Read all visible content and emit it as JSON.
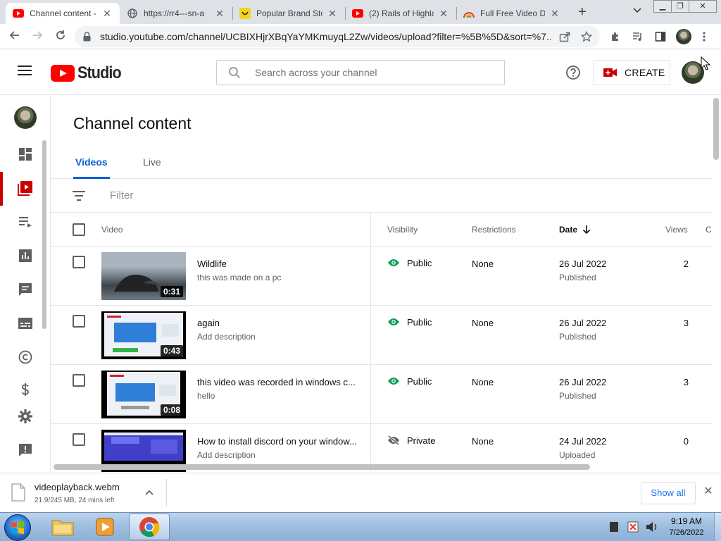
{
  "browser": {
    "tabs": [
      {
        "title": "Channel content -",
        "active": true,
        "icon": "youtube-studio-icon"
      },
      {
        "title": "https://rr4---sn-a",
        "active": false,
        "icon": "globe-icon"
      },
      {
        "title": "Popular Brand Sto",
        "active": false,
        "icon": "smiley-icon"
      },
      {
        "title": "(2) Rails of Highla",
        "active": false,
        "icon": "youtube-icon"
      },
      {
        "title": "Full Free Video Do",
        "active": false,
        "icon": "rainbow-icon"
      }
    ],
    "url": "studio.youtube.com/channel/UCBIXHjrXBqYaYMKmuyqL2Zw/videos/upload?filter=%5B%5D&sort=%7..."
  },
  "header": {
    "brand": "Studio",
    "search_placeholder": "Search across your channel",
    "create_label": "CREATE"
  },
  "page": {
    "title": "Channel content",
    "tabs": [
      {
        "label": "Videos",
        "active": true
      },
      {
        "label": "Live",
        "active": false
      }
    ],
    "filter_label": "Filter",
    "columns": {
      "video": "Video",
      "visibility": "Visibility",
      "restrictions": "Restrictions",
      "date": "Date",
      "views": "Views",
      "comments": "C"
    }
  },
  "videos": [
    {
      "title": "Wildlife",
      "description": "this was made on a pc",
      "duration": "0:31",
      "visibility": "Public",
      "restrictions": "None",
      "date": "26 Jul 2022",
      "status": "Published",
      "views": "2"
    },
    {
      "title": "again",
      "description": "Add description",
      "duration": "0:43",
      "visibility": "Public",
      "restrictions": "None",
      "date": "26 Jul 2022",
      "status": "Published",
      "views": "3"
    },
    {
      "title": "this video was recorded in windows c...",
      "description": "hello",
      "duration": "0:08",
      "visibility": "Public",
      "restrictions": "None",
      "date": "26 Jul 2022",
      "status": "Published",
      "views": "3"
    },
    {
      "title": "How to install discord on your window...",
      "description": "Add description",
      "duration": "",
      "visibility": "Private",
      "restrictions": "None",
      "date": "24 Jul 2022",
      "status": "Uploaded",
      "views": "0"
    }
  ],
  "download": {
    "filename": "videoplayback.webm",
    "progress": "21.9/245 MB, 24 mins left",
    "show_all": "Show all"
  },
  "taskbar": {
    "time": "9:19 AM",
    "date": "7/26/2022"
  },
  "colors": {
    "youtube_red": "#ff0000",
    "accent_blue": "#065fd4",
    "public_green": "#0f9d58"
  }
}
